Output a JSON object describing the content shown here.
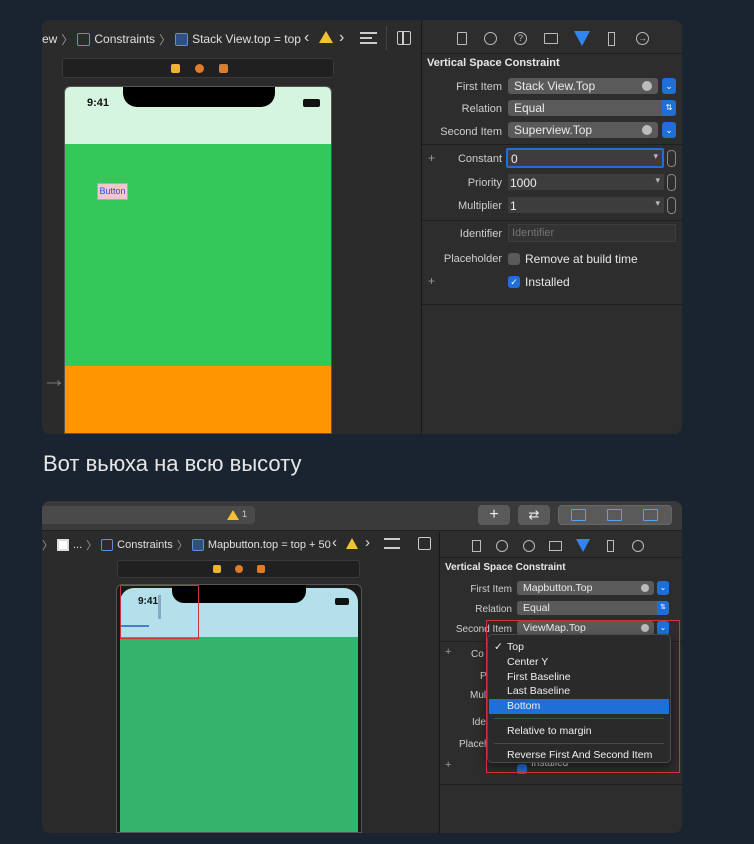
{
  "top": {
    "breadcrumb": {
      "partial": "ew",
      "constraints": "Constraints",
      "item": "Stack View.top = top"
    },
    "panel_title": "Vertical Space Constraint",
    "first_item": {
      "label": "First Item",
      "value": "Stack View.Top"
    },
    "relation": {
      "label": "Relation",
      "value": "Equal"
    },
    "second_item": {
      "label": "Second Item",
      "value": "Superview.Top"
    },
    "constant": {
      "label": "Constant",
      "value": "0"
    },
    "priority": {
      "label": "Priority",
      "value": "1000"
    },
    "multiplier": {
      "label": "Multiplier",
      "value": "1"
    },
    "identifier": {
      "label": "Identifier",
      "placeholder": "Identifier"
    },
    "placeholder": {
      "label": "Placeholder",
      "checkbox": "Remove at build time"
    },
    "installed": "Installed",
    "plus": "+",
    "phone_time": "9:41",
    "button_label": "Button"
  },
  "caption": "Вот вьюха на всю высоту",
  "bottom": {
    "warning_count": "1",
    "plus": "+",
    "breadcrumb": {
      "ellipsis": "...",
      "constraints": "Constraints",
      "item": "Mapbutton.top = top + 50"
    },
    "panel_title": "Vertical Space Constraint",
    "first_item": {
      "label": "First Item",
      "value": "Mapbutton.Top"
    },
    "relation": {
      "label": "Relation",
      "value": "Equal"
    },
    "second_item": {
      "label": "Second Item",
      "value": "ViewMap.Top"
    },
    "hidden_labels": [
      "Co",
      "P",
      "Mul",
      "Ide",
      "Placeh"
    ],
    "installed_partial": "Installed",
    "phone_time": "9:41",
    "menu": {
      "checkmark": "✓",
      "items": [
        "Top",
        "Center Y",
        "First Baseline",
        "Last Baseline",
        "Bottom"
      ],
      "selected": "Bottom",
      "checked": "Top",
      "relative": "Relative to margin",
      "reverse": "Reverse First And Second Item"
    }
  },
  "colors": {
    "accent": "#1f6fd9",
    "green": "#34c759",
    "orange": "#ff9500",
    "mint": "#d6f5e0",
    "map_top": "#b3e0ea",
    "map_green": "#33b36b",
    "highlight_red": "#d0313b"
  }
}
